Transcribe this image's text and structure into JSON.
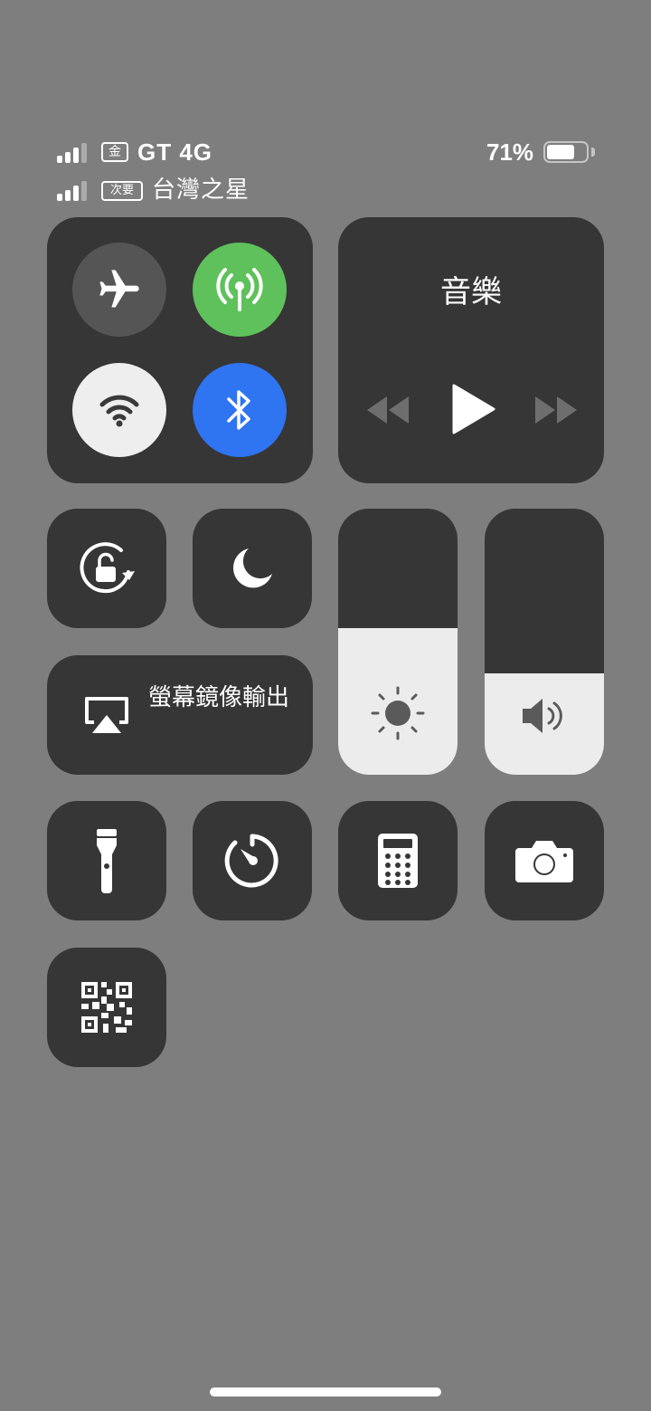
{
  "status_bar": {
    "sim1": {
      "badge": "金",
      "carrier": "GT 4G",
      "signal_bars": 3,
      "signal_max": 4
    },
    "sim2": {
      "badge": "次要",
      "carrier": "台灣之星",
      "signal_bars": 3,
      "signal_max": 4
    },
    "battery": {
      "percent_text": "71%",
      "level": 0.71
    }
  },
  "connectivity": {
    "airplane": {
      "icon": "airplane-icon",
      "active": false
    },
    "cellular": {
      "icon": "cellular-antenna-icon",
      "active": true,
      "color": "#5fc15c"
    },
    "wifi": {
      "icon": "wifi-icon",
      "active": true
    },
    "bluetooth": {
      "icon": "bluetooth-icon",
      "active": true,
      "color": "#2f74f0"
    }
  },
  "music": {
    "title": "音樂",
    "prev_icon": "rewind-icon",
    "play_icon": "play-icon",
    "next_icon": "fast-forward-icon"
  },
  "controls": {
    "rotation_lock_icon": "rotation-lock-icon",
    "do_not_disturb_icon": "moon-icon",
    "screen_mirroring": {
      "label": "螢幕鏡像輸出",
      "icon": "airplay-icon"
    }
  },
  "sliders": {
    "brightness": {
      "level": 0.55,
      "icon": "sun-icon"
    },
    "volume": {
      "level": 0.38,
      "icon": "speaker-icon"
    }
  },
  "shortcuts": [
    {
      "name": "flashlight",
      "icon": "flashlight-icon"
    },
    {
      "name": "timer",
      "icon": "timer-icon"
    },
    {
      "name": "calculator",
      "icon": "calculator-icon"
    },
    {
      "name": "camera",
      "icon": "camera-icon"
    },
    {
      "name": "qr-scanner",
      "icon": "qr-code-icon"
    }
  ],
  "colors": {
    "background": "#7e7e7e",
    "tile": "#363636",
    "green": "#5fc15c",
    "blue": "#2f74f0"
  }
}
